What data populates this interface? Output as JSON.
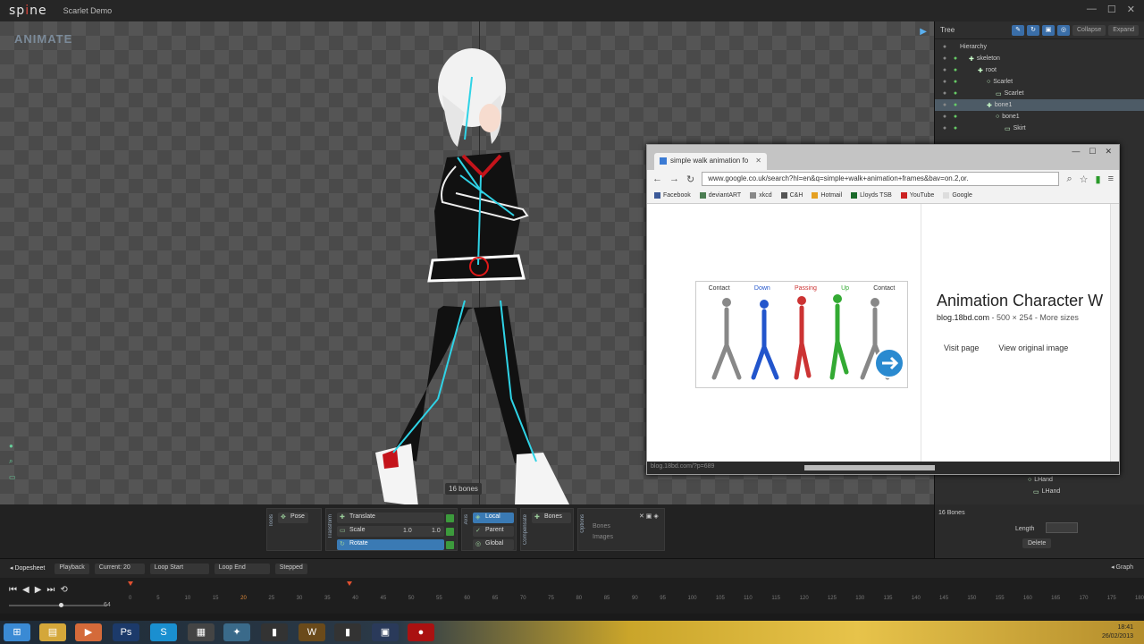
{
  "app": {
    "logo_left": "sp",
    "logo_dot": "i",
    "logo_right": "ne",
    "doc_title": "Scarlet Demo",
    "window_ctrls": [
      "—",
      "☐",
      "✕"
    ]
  },
  "viewport": {
    "mode": "ANIMATE",
    "bones_count": "16 bones"
  },
  "tree": {
    "title": "Tree",
    "collapse": "Collapse",
    "expand": "Expand",
    "rows": [
      {
        "label": "Hierarchy",
        "indent": 0,
        "icon": "",
        "sel": false
      },
      {
        "label": "skeleton",
        "indent": 1,
        "icon": "✚",
        "sel": false
      },
      {
        "label": "root",
        "indent": 2,
        "icon": "✚",
        "sel": false
      },
      {
        "label": "Scarlet",
        "indent": 3,
        "icon": "○",
        "sel": false
      },
      {
        "label": "Scarlet",
        "indent": 4,
        "icon": "▭",
        "sel": false
      },
      {
        "label": "bone1",
        "indent": 3,
        "icon": "✚",
        "sel": true
      },
      {
        "label": "bone1",
        "indent": 4,
        "icon": "○",
        "sel": false
      },
      {
        "label": "Skirt",
        "indent": 5,
        "icon": "▭",
        "sel": false
      }
    ],
    "tail_rows": [
      {
        "label": "LHand",
        "indent": 4,
        "icon": "○"
      },
      {
        "label": "LHand",
        "indent": 5,
        "icon": "▭"
      }
    ]
  },
  "browser": {
    "tab_title": "simple walk animation fo",
    "window_ctrls": [
      "—",
      "☐",
      "✕"
    ],
    "url": "www.google.co.uk/search?hl=en&q=simple+walk+animation+frames&bav=on.2,or.",
    "bookmarks": [
      {
        "label": "Facebook",
        "color": "#3b5998"
      },
      {
        "label": "deviantART",
        "color": "#4b7d52"
      },
      {
        "label": "xkcd",
        "color": "#888888"
      },
      {
        "label": "C&H",
        "color": "#555555"
      },
      {
        "label": "Hotmail",
        "color": "#e5a021"
      },
      {
        "label": "Lloyds TSB",
        "color": "#1a6a2a"
      },
      {
        "label": "YouTube",
        "color": "#cc2222"
      },
      {
        "label": "Google",
        "color": "#dddddd"
      }
    ],
    "walk_labels": [
      "Contact",
      "Down",
      "Passing",
      "Up",
      "Contact"
    ],
    "walk_colors": [
      "#333333",
      "#2255cc",
      "#cc3333",
      "#33aa33",
      "#333333"
    ],
    "result_title": "Animation Character W",
    "result_domain": "blog.18bd.com",
    "result_size": " - 500 × 254 - More sizes",
    "visit_page": "Visit page",
    "view_original": "View original image",
    "status_url": "blog.18bd.com/?p=689"
  },
  "tools": {
    "pose_label": "Pose",
    "tools_title": "Tools",
    "transform_title": "Transform",
    "translate_label": "Translate",
    "scale_label": "Scale",
    "rotate_label": "Rotate",
    "scale_x": "1.0",
    "scale_y": "1.0",
    "axis_title": "Axis",
    "local_label": "Local",
    "parent_label": "Parent",
    "global_label": "Global",
    "compensate_title": "Compensate",
    "bones_label": "Bones",
    "options_title": "Options",
    "opt_bones": "Bones",
    "opt_images": "Images"
  },
  "bones_panel": {
    "title": "16 Bones",
    "length_label": "Length",
    "delete_label": "Delete"
  },
  "dopesheet": {
    "dopesheet_label": "Dopesheet",
    "playback_label": "Playback",
    "current_label": "Current: 20",
    "loop_start": "Loop Start",
    "loop_end": "Loop End",
    "stepped": "Stepped",
    "graph": "Graph"
  },
  "timeline": {
    "controls": [
      "⏮",
      "◀",
      "▶",
      "⏭",
      "⟲"
    ],
    "fps": "64",
    "ticks": [
      "0",
      "5",
      "10",
      "15",
      "20",
      "25",
      "30",
      "35",
      "40",
      "45",
      "50",
      "55",
      "60",
      "65",
      "70",
      "75",
      "80",
      "85",
      "90",
      "95",
      "100",
      "105",
      "110",
      "115",
      "120",
      "125",
      "130",
      "135",
      "140",
      "145",
      "150",
      "155",
      "160",
      "165",
      "170",
      "175",
      "180"
    ],
    "current_frame": 20
  },
  "taskbar": {
    "icons": [
      {
        "name": "start-orb-icon",
        "glyph": "⊞",
        "color": "#3a8ad4"
      },
      {
        "name": "explorer-icon",
        "glyph": "▤",
        "color": "#d4a73a"
      },
      {
        "name": "media-player-icon",
        "glyph": "▶",
        "color": "#d46a3a"
      },
      {
        "name": "photoshop-icon",
        "glyph": "Ps",
        "color": "#1c3a6a"
      },
      {
        "name": "skype-icon",
        "glyph": "S",
        "color": "#1a8fd0"
      },
      {
        "name": "notes-icon",
        "glyph": "▦",
        "color": "#444444"
      },
      {
        "name": "network-icon",
        "glyph": "✦",
        "color": "#3a6a8a"
      },
      {
        "name": "app-icon",
        "glyph": "▮",
        "color": "#333333"
      },
      {
        "name": "wow-icon",
        "glyph": "W",
        "color": "#6a4a1a"
      },
      {
        "name": "spine-icon",
        "glyph": "▮",
        "color": "#333333"
      },
      {
        "name": "screen-icon",
        "glyph": "▣",
        "color": "#2a3a5a"
      },
      {
        "name": "record-icon",
        "glyph": "●",
        "color": "#aa1111"
      }
    ],
    "time": "18:41",
    "date": "26/02/2013"
  }
}
